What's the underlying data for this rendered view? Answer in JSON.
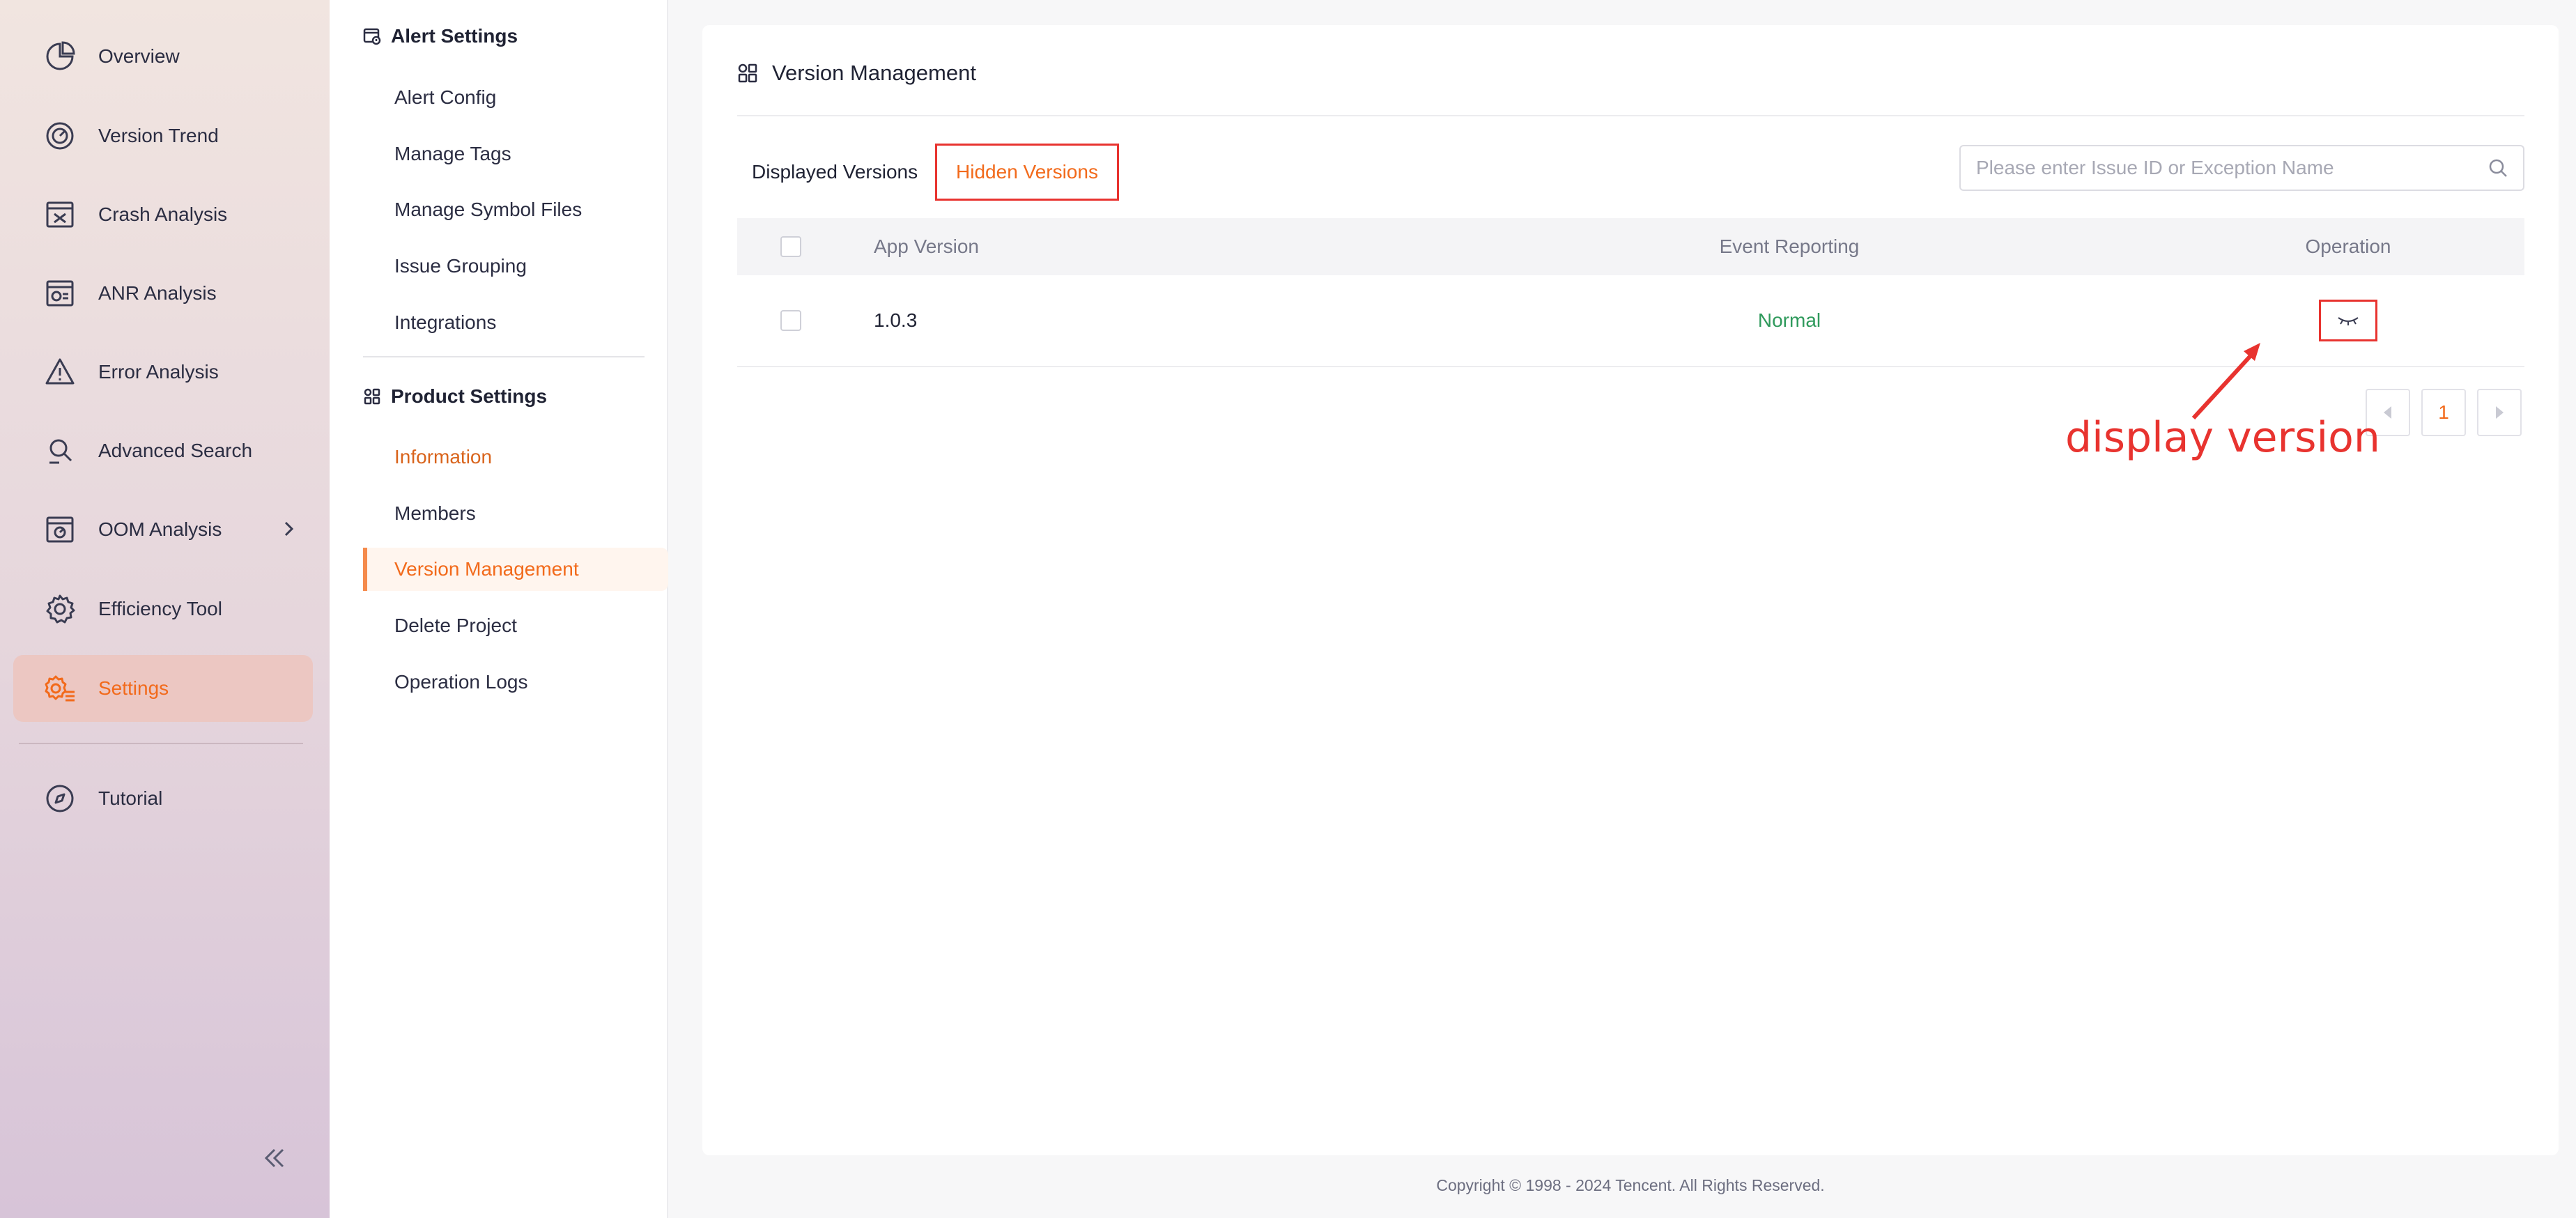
{
  "nav": {
    "items": [
      {
        "label": "Overview",
        "icon": "pie-chart-icon"
      },
      {
        "label": "Version Trend",
        "icon": "gauge-icon"
      },
      {
        "label": "Crash Analysis",
        "icon": "crash-window-icon"
      },
      {
        "label": "ANR Analysis",
        "icon": "anr-window-icon"
      },
      {
        "label": "Error Analysis",
        "icon": "warning-icon"
      },
      {
        "label": "Advanced Search",
        "icon": "search-doc-icon"
      },
      {
        "label": "OOM Analysis",
        "icon": "oom-window-icon"
      },
      {
        "label": "Efficiency Tool",
        "icon": "gear-icon"
      },
      {
        "label": "Settings",
        "icon": "settings-list-icon"
      },
      {
        "label": "Tutorial",
        "icon": "compass-icon"
      }
    ]
  },
  "submenu": {
    "alert_title": "Alert Settings",
    "alert_items": [
      "Alert Config",
      "Manage Tags",
      "Manage Symbol Files",
      "Issue Grouping",
      "Integrations"
    ],
    "product_title": "Product Settings",
    "product_items": [
      "Information",
      "Members",
      "Version Management",
      "Delete Project",
      "Operation Logs"
    ]
  },
  "main": {
    "title": "Version Management",
    "tabs": [
      "Displayed Versions",
      "Hidden Versions"
    ],
    "search_placeholder": "Please enter Issue ID or Exception Name",
    "columns": [
      "App Version",
      "Event Reporting",
      "Operation"
    ],
    "rows": [
      {
        "version": "1.0.3",
        "event_reporting": "Normal"
      }
    ],
    "page": "1"
  },
  "annotation": "display version",
  "footer": "Copyright © 1998 - 2024 Tencent. All Rights Reserved.",
  "colors": {
    "accent": "#f26a1b",
    "highlight_box": "#e8332f",
    "status_normal": "#2f9a5c"
  }
}
